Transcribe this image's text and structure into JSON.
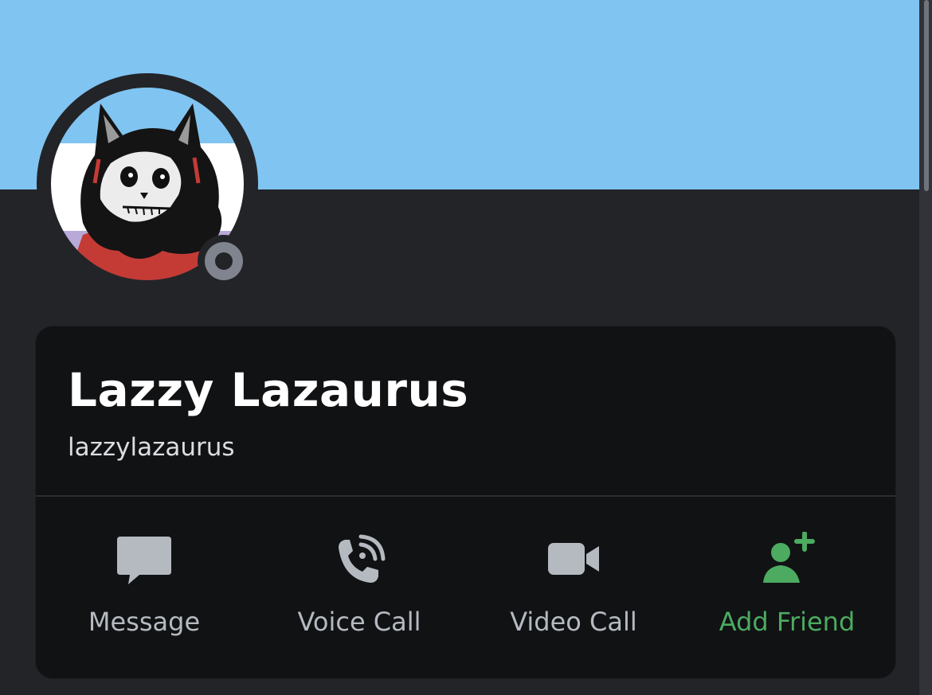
{
  "profile": {
    "display_name": "Lazzy Lazaurus",
    "username": "lazzylazaurus",
    "status": "offline"
  },
  "actions": [
    {
      "label": "Message",
      "icon": "message-icon"
    },
    {
      "label": "Voice Call",
      "icon": "voice-call-icon"
    },
    {
      "label": "Video Call",
      "icon": "video-call-icon"
    },
    {
      "label": "Add Friend",
      "icon": "add-friend-icon"
    }
  ],
  "colors": {
    "banner": "#80c4f1",
    "background": "#232428",
    "card": "#111214",
    "action_icon": "#b5bac1",
    "add_friend": "#4cab60",
    "status_offline": "#80848e"
  }
}
